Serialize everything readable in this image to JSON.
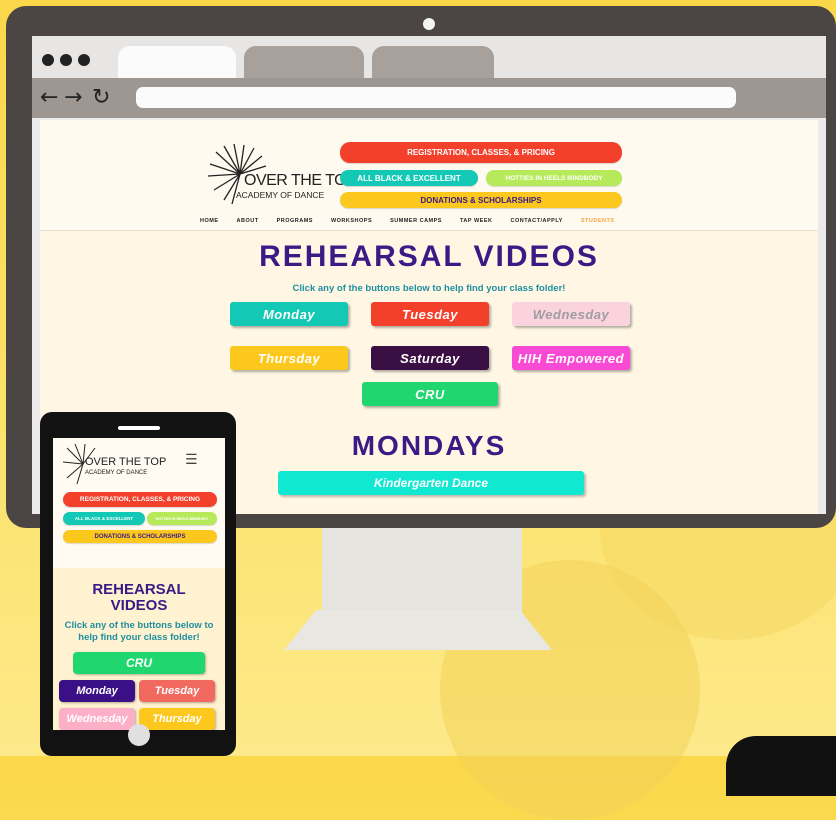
{
  "site": {
    "logo_main": "OVER THE TOP",
    "logo_sub": "ACADEMY OF DANCE"
  },
  "header_pills": {
    "registration": "REGISTRATION, CLASSES, & PRICING",
    "all_black": "ALL BLACK & EXCELLENT",
    "hotties": "HOTTIES IN HEELS MINDBODY",
    "donations": "DONATIONS & SCHOLARSHIPS"
  },
  "nav": [
    "HOME",
    "ABOUT",
    "PROGRAMS",
    "WORKSHOPS",
    "SUMMER CAMPS",
    "TAP WEEK",
    "CONTACT/APPLY",
    "STUDENTS"
  ],
  "main": {
    "title": "REHEARSAL VIDEOS",
    "subtitle": "Click any of the buttons below to help find your class folder!",
    "day_buttons": [
      "Monday",
      "Tuesday",
      "Wednesday",
      "Thursday",
      "Saturday",
      "HIH Empowered",
      "CRU"
    ],
    "section_title": "MONDAYS",
    "class_button": "Kindergarten Dance"
  },
  "mobile": {
    "menu_icon": "☰",
    "title_line1": "REHEARSAL",
    "title_line2": "VIDEOS",
    "subtitle": "Click any of the buttons below to help find your class folder!",
    "cru": "CRU",
    "monday": "Monday",
    "tuesday": "Tuesday",
    "wednesday": "Wednesday",
    "thursday": "Thursday"
  },
  "colors": {
    "red": "#f2402b",
    "teal": "#14c8b6",
    "lime": "#b6ea5a",
    "yellow": "#fcc81d",
    "purple": "#3b1a86",
    "pink": "#f94ad6",
    "green": "#1fd66f",
    "light_pink": "#fbd3de",
    "dark_purple": "#3a0f44"
  }
}
